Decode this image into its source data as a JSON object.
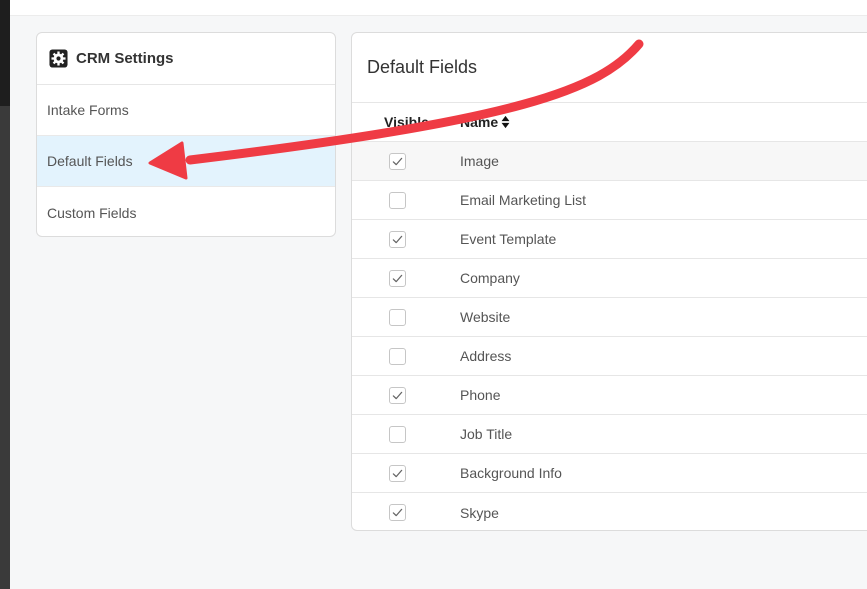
{
  "sidebar": {
    "title": "CRM Settings",
    "title_icon": "gear-icon",
    "items": [
      {
        "label": "Intake Forms",
        "active": false
      },
      {
        "label": "Default Fields",
        "active": true
      },
      {
        "label": "Custom Fields",
        "active": false
      }
    ]
  },
  "main": {
    "title": "Default Fields",
    "columns": {
      "visible": "Visible",
      "name": "Name"
    },
    "rows": [
      {
        "name": "Image",
        "visible": true
      },
      {
        "name": "Email Marketing List",
        "visible": false
      },
      {
        "name": "Event Template",
        "visible": true
      },
      {
        "name": "Company",
        "visible": true
      },
      {
        "name": "Website",
        "visible": false
      },
      {
        "name": "Address",
        "visible": false
      },
      {
        "name": "Phone",
        "visible": true
      },
      {
        "name": "Job Title",
        "visible": false
      },
      {
        "name": "Background Info",
        "visible": true
      },
      {
        "name": "Skype",
        "visible": true
      }
    ]
  },
  "colors": {
    "active_item_bg": "#e3f3fd",
    "annotation_arrow": "#ef3b44"
  }
}
